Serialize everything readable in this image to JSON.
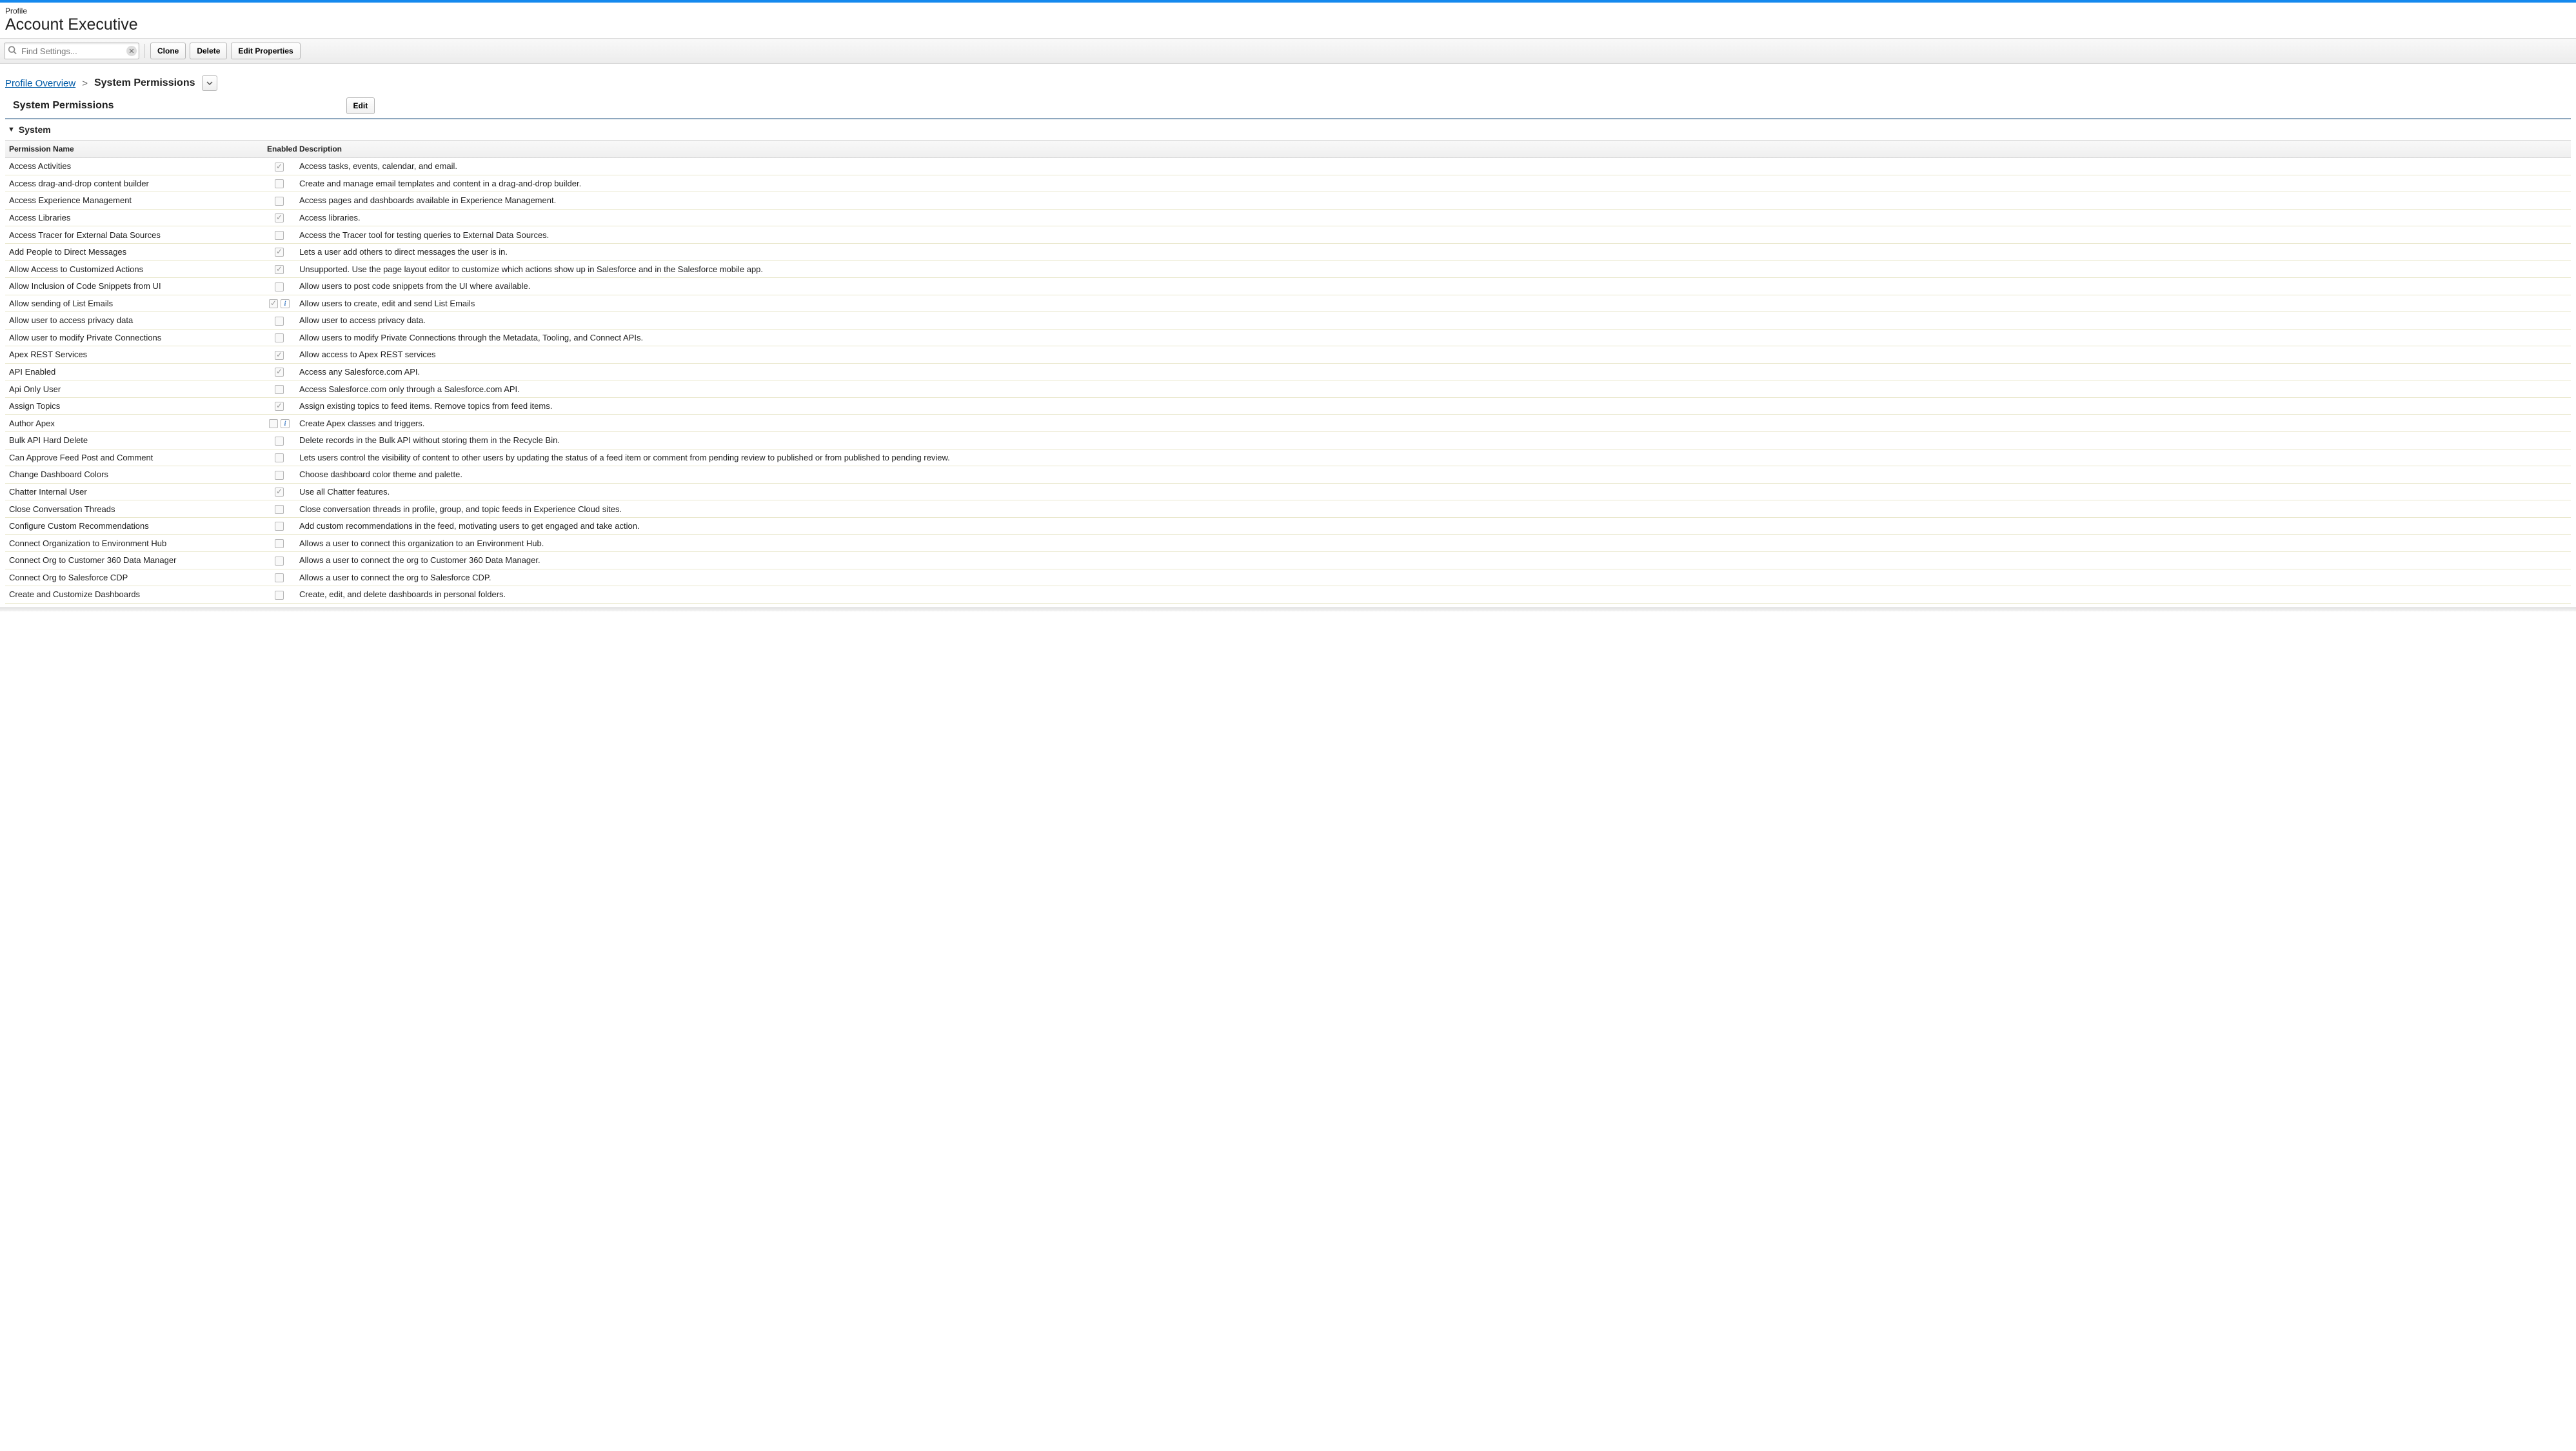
{
  "header": {
    "sub": "Profile",
    "title": "Account Executive"
  },
  "toolbar": {
    "search_placeholder": "Find Settings...",
    "clone": "Clone",
    "delete": "Delete",
    "edit_properties": "Edit Properties"
  },
  "breadcrumb": {
    "root": "Profile Overview",
    "sep": ">",
    "current": "System Permissions"
  },
  "section": {
    "title": "System Permissions",
    "edit": "Edit",
    "group": "System"
  },
  "columns": {
    "name": "Permission Name",
    "enabled": "Enabled",
    "description": "Description"
  },
  "permissions": [
    {
      "name": "Access Activities",
      "enabled": true,
      "info": false,
      "desc": "Access tasks, events, calendar, and email."
    },
    {
      "name": "Access drag-and-drop content builder",
      "enabled": false,
      "info": false,
      "desc": "Create and manage email templates and content in a drag-and-drop builder."
    },
    {
      "name": "Access Experience Management",
      "enabled": false,
      "info": false,
      "desc": "Access pages and dashboards available in Experience Management."
    },
    {
      "name": "Access Libraries",
      "enabled": true,
      "info": false,
      "desc": "Access libraries."
    },
    {
      "name": "Access Tracer for External Data Sources",
      "enabled": false,
      "info": false,
      "desc": "Access the Tracer tool for testing queries to External Data Sources."
    },
    {
      "name": "Add People to Direct Messages",
      "enabled": true,
      "info": false,
      "desc": "Lets a user add others to direct messages the user is in."
    },
    {
      "name": "Allow Access to Customized Actions",
      "enabled": true,
      "info": false,
      "desc": "Unsupported. Use the page layout editor to customize which actions show up in Salesforce and in the Salesforce mobile app."
    },
    {
      "name": "Allow Inclusion of Code Snippets from UI",
      "enabled": false,
      "info": false,
      "desc": "Allow users to post code snippets from the UI where available."
    },
    {
      "name": "Allow sending of List Emails",
      "enabled": true,
      "info": true,
      "desc": "Allow users to create, edit and send List Emails"
    },
    {
      "name": "Allow user to access privacy data",
      "enabled": false,
      "info": false,
      "desc": "Allow user to access privacy data."
    },
    {
      "name": "Allow user to modify Private Connections",
      "enabled": false,
      "info": false,
      "desc": "Allow users to modify Private Connections through the Metadata, Tooling, and Connect APIs."
    },
    {
      "name": "Apex REST Services",
      "enabled": true,
      "info": false,
      "desc": "Allow access to Apex REST services"
    },
    {
      "name": "API Enabled",
      "enabled": true,
      "info": false,
      "desc": "Access any Salesforce.com API."
    },
    {
      "name": "Api Only User",
      "enabled": false,
      "info": false,
      "desc": "Access Salesforce.com only through a Salesforce.com API."
    },
    {
      "name": "Assign Topics",
      "enabled": true,
      "info": false,
      "desc": "Assign existing topics to feed items. Remove topics from feed items."
    },
    {
      "name": "Author Apex",
      "enabled": false,
      "info": true,
      "desc": "Create Apex classes and triggers."
    },
    {
      "name": "Bulk API Hard Delete",
      "enabled": false,
      "info": false,
      "desc": "Delete records in the Bulk API without storing them in the Recycle Bin."
    },
    {
      "name": "Can Approve Feed Post and Comment",
      "enabled": false,
      "info": false,
      "desc": "Lets users control the visibility of content to other users by updating the status of a feed item or comment from pending review to published or from published to pending review."
    },
    {
      "name": "Change Dashboard Colors",
      "enabled": false,
      "info": false,
      "desc": "Choose dashboard color theme and palette."
    },
    {
      "name": "Chatter Internal User",
      "enabled": true,
      "info": false,
      "desc": "Use all Chatter features."
    },
    {
      "name": "Close Conversation Threads",
      "enabled": false,
      "info": false,
      "desc": "Close conversation threads in profile, group, and topic feeds in Experience Cloud sites."
    },
    {
      "name": "Configure Custom Recommendations",
      "enabled": false,
      "info": false,
      "desc": "Add custom recommendations in the feed, motivating users to get engaged and take action."
    },
    {
      "name": "Connect Organization to Environment Hub",
      "enabled": false,
      "info": false,
      "desc": "Allows a user to connect this organization to an Environment Hub."
    },
    {
      "name": "Connect Org to Customer 360 Data Manager",
      "enabled": false,
      "info": false,
      "desc": "Allows a user to connect the org to Customer 360 Data Manager."
    },
    {
      "name": "Connect Org to Salesforce CDP",
      "enabled": false,
      "info": false,
      "desc": "Allows a user to connect the org to Salesforce CDP."
    },
    {
      "name": "Create and Customize Dashboards",
      "enabled": false,
      "info": false,
      "desc": "Create, edit, and delete dashboards in personal folders."
    }
  ]
}
